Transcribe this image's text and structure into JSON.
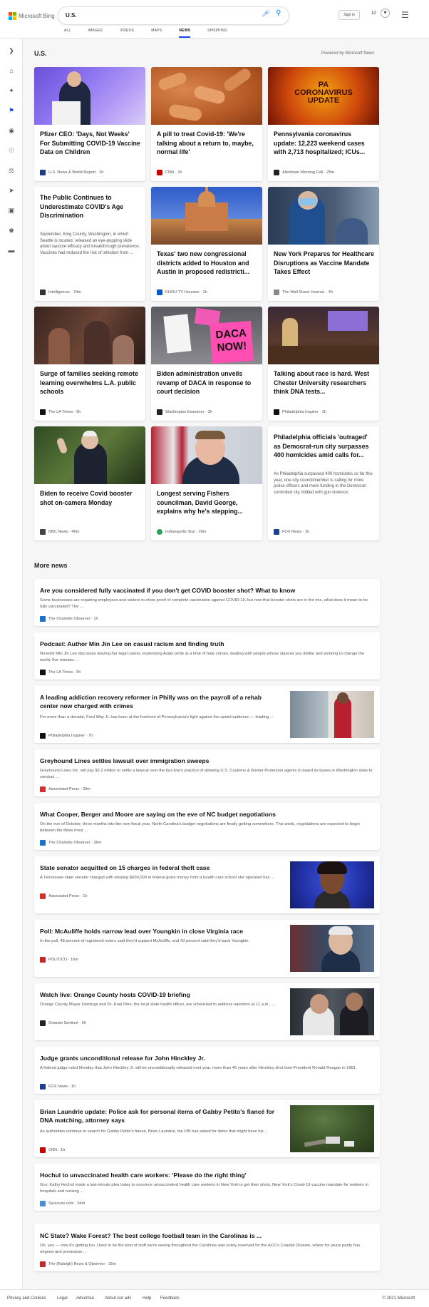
{
  "header": {
    "brand": "Microsoft Bing",
    "query": "U.S.",
    "sign_in": "Sign in",
    "points": "10",
    "tabs": [
      {
        "label": "ALL"
      },
      {
        "label": "IMAGES"
      },
      {
        "label": "VIDEOS"
      },
      {
        "label": "MAPS"
      },
      {
        "label": "NEWS"
      },
      {
        "label": "SHOPPING"
      }
    ]
  },
  "sidebar": {
    "icons": [
      "chevron-right-icon",
      "home-icon",
      "sparkle-icon",
      "flag-icon",
      "location-icon",
      "globe-icon",
      "scale-icon",
      "rocket-icon",
      "film-icon",
      "bank-icon",
      "card-icon"
    ]
  },
  "section": {
    "title": "U.S.",
    "powered_by": "Powered by Microsoft News",
    "more_title": "More news"
  },
  "cards": [
    {
      "title": "Pfizer CEO: 'Days, Not Weeks' For Submitting COVID-19 Vaccine Data on Children",
      "snippet": "",
      "source": "U.S. News & World Report",
      "age": "1h",
      "logo_color": "#1f3c88"
    },
    {
      "title": "A pill to treat Covid-19: 'We're talking about a return to, maybe, normal life'",
      "snippet": "",
      "source": "CNN",
      "age": "2h",
      "logo_color": "#cc0000"
    },
    {
      "title": "Pennsylvania coronavirus update: 12,223 weekend cases with 2,713 hospitalized; ICUs...",
      "snippet": "",
      "source": "Allentown Morning Call",
      "age": "25m",
      "logo_color": "#222222"
    },
    {
      "title": "The Public Continues to Underestimate COVID's Age Discrimination",
      "snippet": "September, King County, Washington, in which Seattle is located, released an eye-popping slide about vaccine efficacy and breakthrough prevalence: Vaccines had reduced the risk of infection from ...",
      "source": "Intelligencer",
      "age": "24m",
      "logo_color": "#333333"
    },
    {
      "title": "Texas' two new congressional districts added to Houston and Austin in proposed redistricti...",
      "snippet": "",
      "source": "KHOU-TV Houston",
      "age": "1h",
      "logo_color": "#0a58ca"
    },
    {
      "title": "New York Prepares for Healthcare Disruptions as Vaccine Mandate Takes Effect",
      "snippet": "",
      "source": "The Wall Street Journal.",
      "age": "4h",
      "logo_color": "#888888"
    },
    {
      "title": "Surge of families seeking remote learning overwhelms L.A. public schools",
      "snippet": "",
      "source": "The LA Times",
      "age": "5h",
      "logo_color": "#111111"
    },
    {
      "title": "Biden administration unveils revamp of DACA in response to court decision",
      "snippet": "",
      "source": "Washington Examiner",
      "age": "3h",
      "logo_color": "#222222"
    },
    {
      "title": "Talking about race is hard. West Chester University researchers think DNA tests...",
      "snippet": "",
      "source": "Philadelphia Inquirer",
      "age": "2h",
      "logo_color": "#111111"
    },
    {
      "title": "Biden to receive Covid booster shot on-camera Monday",
      "snippet": "",
      "source": "NBC News",
      "age": "48m",
      "logo_color": "#444444"
    },
    {
      "title": "Longest serving Fishers councilman, David George, explains why he's stepping...",
      "snippet": "",
      "source": "Indianapolis Star",
      "age": "26m",
      "logo_color": "#2e9e5b"
    },
    {
      "title": "Philadelphia officials 'outraged' as Democrat-run city surpasses 400 homicides amid calls for...",
      "snippet": "As Philadelphia surpassed 400 homicides so far this year, one city councilmember is calling for more police officers and more funding in the Democrat-controlled city riddled with gun violence.",
      "source": "FOX News",
      "age": "1h",
      "logo_color": "#1c3f94"
    }
  ],
  "more_news": [
    {
      "title": "Are you considered fully vaccinated if you don't get COVID booster shot? What to know",
      "snippet": "Some businesses are requiring employees and visitors to show proof of complete vaccination against COVID-19, but now that booster shots are in the mix, what does it mean to be fully vaccinated? The ...",
      "source": "The Charlotte Observer",
      "age": "1h",
      "logo_color": "#1a73c8"
    },
    {
      "title": "Podcast: Author Min Jin Lee on casual racism and finding truth",
      "snippet": "Novelist Min Jin Lee discusses leaving her legal career, expressing Asian pride at a time of hate crimes, dealing with people whose stances you dislike and working to change the world, five minutes ...",
      "source": "The LA Times",
      "age": "5h",
      "logo_color": "#111111"
    },
    {
      "title": "A leading addiction recovery reformer in Philly was on the payroll of a rehab center now charged with crimes",
      "snippet": "For more than a decade, Fred Way Jr. has been at the forefront of Pennsylvania's fight against the opioid epidemic — leading ...",
      "source": "Philadelphia Inquirer",
      "age": "7h",
      "logo_color": "#111111"
    },
    {
      "title": "Greyhound Lines settles lawsuit over immigration sweeps",
      "snippet": "Greyhound Lines Inc. will pay $2.2 million to settle a lawsuit over the bus line's practice of allowing U.S. Customs & Border Protection agents to board its buses in Washington state to conduct ...",
      "source": "Associated Press",
      "age": "39m",
      "logo_color": "#d32f2f"
    },
    {
      "title": "What Cooper, Berger and Moore are saying on the eve of NC budget negotiations",
      "snippet": "On the eve of October, three months into the new fiscal year, North Carolina's budget negotiations are finally getting somewhere. This week, negotiations are expected to begin between the three most ...",
      "source": "The Charlotte Observer",
      "age": "36m",
      "logo_color": "#1a73c8"
    },
    {
      "title": "State senator acquitted on 15 charges in federal theft case",
      "snippet": "A Tennessee state senator charged with stealing $600,000 in federal grant money from a health care school she operated has ...",
      "source": "Associated Press",
      "age": "1h",
      "logo_color": "#d32f2f"
    },
    {
      "title": "Poll: McAuliffe holds narrow lead over Youngkin in close Virginia race",
      "snippet": "In the poll, 48 percent of registered voters said they'd support McAuliffe, and 43 percent said they'd back Youngkin.",
      "source": "POLITICO",
      "age": "16m",
      "logo_color": "#c62828"
    },
    {
      "title": "Watch live: Orange County hosts COVID-19 briefing",
      "snippet": "Orange County Mayor Demings and Dr. Raul Pino, the local state health officer, are scheduled to address reporters at 11 a.m., ...",
      "source": "Orlando Sentinel",
      "age": "2h",
      "logo_color": "#222222"
    },
    {
      "title": "Judge grants unconditional release for John Hinckley Jr.",
      "snippet": "A federal judge ruled Monday that John Hinckley Jr. will be unconditionally released next year, more than 40 years after Hinckley shot then-President Ronald Reagan in 1981.",
      "source": "FOX News",
      "age": "1h",
      "logo_color": "#1c3f94"
    },
    {
      "title": "Brian Laundrie update: Police ask for personal items of Gabby Petito's fiancé for DNA matching, attorney says",
      "snippet": "As authorities continue to search for Gabby Petito's fiancé, Brian Laundrie, the FBI has asked for items that might have his ...",
      "source": "CNN",
      "age": "1h",
      "logo_color": "#cc0000"
    },
    {
      "title": "Hochul to unvaccinated health care workers: 'Please do the right thing'",
      "snippet": "Gov. Kathy Hochul made a last-minute plea today to convince unvaccinated health care workers in New York to get their shots. New York's Covid-19 vaccine mandate for workers in hospitals and nursing ...",
      "source": "Syracuse.com",
      "age": "54m",
      "logo_color": "#4a90d9"
    },
    {
      "title": "NC State? Wake Forest? The best college football team in the Carolinas is ...",
      "snippet": "Oh, yes — now it's getting fun. Used to be the kind of stuff we're seeing throughout the Carolinas was solely reserved for the ACC's Coastal Division, where for years parity has reigned and preseason ...",
      "source": "The (Raleigh) News & Observer",
      "age": "35m",
      "logo_color": "#c62828"
    }
  ],
  "footer": {
    "links": [
      "Privacy and Cookies",
      "Legal",
      "Advertise",
      "About our ads",
      "Help",
      "Feedback"
    ],
    "copyright": "© 2021 Microsoft"
  }
}
